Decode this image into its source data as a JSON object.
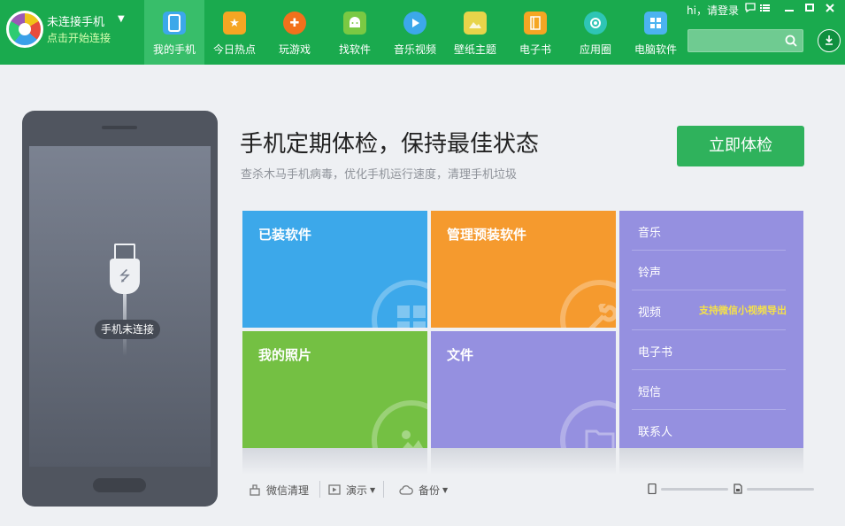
{
  "brand": {
    "title": "未连接手机",
    "subtitle": "点击开始连接"
  },
  "nav": [
    {
      "label": "我的手机",
      "icon": "phone-icon",
      "color": "#3ca8ea",
      "active": true
    },
    {
      "label": "今日热点",
      "icon": "hot-news-icon",
      "color": "#f5a623",
      "active": false
    },
    {
      "label": "玩游戏",
      "icon": "gamepad-icon",
      "color": "#f2711c",
      "active": false
    },
    {
      "label": "找软件",
      "icon": "android-icon",
      "color": "#7ac943",
      "active": false
    },
    {
      "label": "音乐视频",
      "icon": "play-icon",
      "color": "#3ca8ea",
      "active": false
    },
    {
      "label": "壁纸主题",
      "icon": "wallpaper-icon",
      "color": "#e7d44a",
      "active": false
    },
    {
      "label": "电子书",
      "icon": "book-icon",
      "color": "#f5a623",
      "active": false
    },
    {
      "label": "应用圈",
      "icon": "app-circle-icon",
      "color": "#2ec5b5",
      "active": false
    },
    {
      "label": "电脑软件",
      "icon": "windows-icon",
      "color": "#4bb3f0",
      "active": false
    }
  ],
  "top_right": {
    "login": "hi，请登录",
    "search_placeholder": ""
  },
  "phone": {
    "status": "手机未连接"
  },
  "main": {
    "headline": "手机定期体检，保持最佳状态",
    "subline": "查杀木马手机病毒，优化手机运行速度，清理手机垃圾",
    "check_button": "立即体检"
  },
  "tiles": {
    "apps": "已装软件",
    "preinstalled": "管理预装软件",
    "photos": "我的照片",
    "files": "文件"
  },
  "media_list": [
    {
      "label": "音乐",
      "note": ""
    },
    {
      "label": "铃声",
      "note": ""
    },
    {
      "label": "视频",
      "note": "支持微信小视频导出"
    },
    {
      "label": "电子书",
      "note": ""
    },
    {
      "label": "短信",
      "note": ""
    },
    {
      "label": "联系人",
      "note": ""
    }
  ],
  "toolbar": {
    "wechat_clean": "微信清理",
    "demo": "演示",
    "backup": "备份"
  },
  "storage": {
    "phone_fraction": 0,
    "sd_fraction": 0
  },
  "colors": {
    "topbar": "#1aaa4e",
    "accent": "#2fb25c",
    "tile_blue": "#3ca8ea",
    "tile_orange": "#f59a2e",
    "tile_green": "#74c043",
    "tile_purple": "#9590e0",
    "highlight_note": "#f5e14a"
  }
}
